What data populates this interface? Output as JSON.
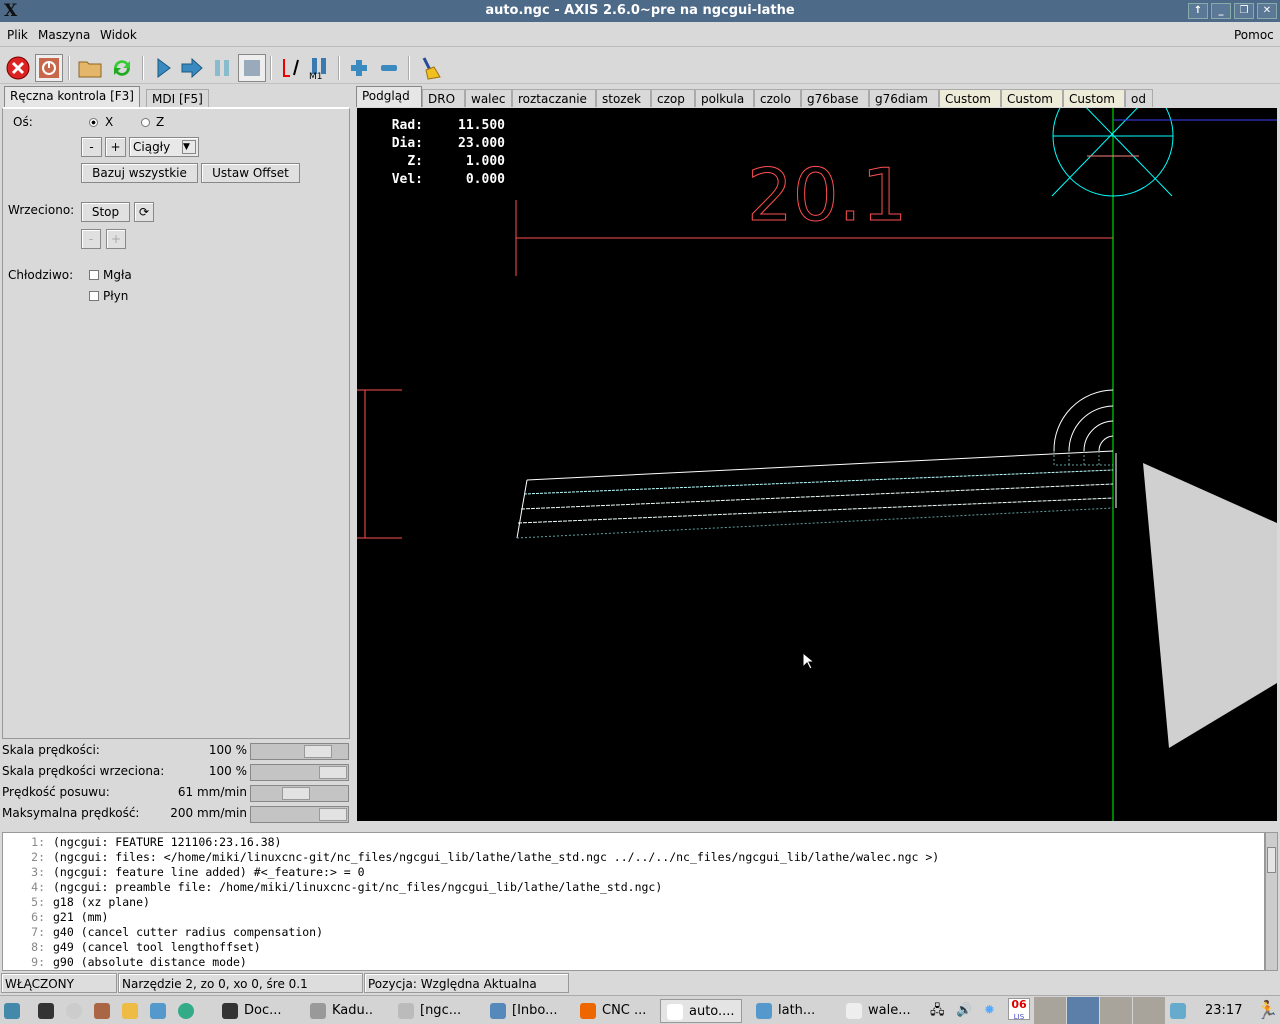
{
  "window": {
    "title": "auto.ngc - AXIS 2.6.0~pre na ngcgui-lathe",
    "logo": "X"
  },
  "menu": {
    "items": [
      "Plik",
      "Maszyna",
      "Widok"
    ],
    "help": "Pomoc"
  },
  "toolbar": {
    "icons": [
      "estop-icon",
      "power-icon",
      "open-file-icon",
      "reload-icon",
      "run-icon",
      "step-icon",
      "pause-icon",
      "stop-icon",
      "run-from-line-icon",
      "optional-stop-icon",
      "zoom-in-icon",
      "zoom-out-icon",
      "clear-plot-icon"
    ],
    "m1_label": "M1"
  },
  "left_tabs": [
    "Ręczna kontrola [F3]",
    "MDI [F5]"
  ],
  "manual": {
    "axis_label": "Oś:",
    "axis_x": "X",
    "axis_z": "Z",
    "axis_selected": "X",
    "minus": "-",
    "plus": "+",
    "jog_mode": "Ciągły",
    "home_all": "Bazuj wszystkie",
    "touch_off": "Ustaw Offset",
    "spindle_label": "Wrzeciono:",
    "spindle_stop": "Stop",
    "coolant_label": "Chłodziwo:",
    "mist": "Mgła",
    "flood": "Płyn"
  },
  "sliders": [
    {
      "label": "Skala prędkości:",
      "value": "100 %",
      "fraction": 0.78
    },
    {
      "label": "Skala prędkości wrzeciona:",
      "value": "100 %",
      "fraction": 1.0
    },
    {
      "label": "Prędkość posuwu:",
      "value": "61 mm/min",
      "fraction": 0.45
    },
    {
      "label": "Maksymalna prędkość:",
      "value": "200 mm/min",
      "fraction": 1.0
    }
  ],
  "right_tabs": [
    "Podgląd",
    "DRO",
    "walec",
    "roztaczanie",
    "stozek",
    "czop",
    "polkula",
    "czolo",
    "g76base",
    "g76diam",
    "Custom",
    "Custom",
    "Custom",
    "od"
  ],
  "dro": [
    {
      "label": "Rad:",
      "value": "11.500"
    },
    {
      "label": "Dia:",
      "value": "23.000"
    },
    {
      "label": "Z:",
      "value": "1.000"
    },
    {
      "label": "Vel:",
      "value": "0.000"
    }
  ],
  "preview": {
    "dimension": "20.1",
    "colors": {
      "dimension": "#ff5050",
      "spindle_axis": "#00ff00",
      "tool": "#00ffff",
      "path": "#ffffff",
      "rapid": "#5fa0a0"
    }
  },
  "console": [
    "(ngcgui: FEATURE 121106:23.16.38)",
    "(ngcgui: files: </home/miki/linuxcnc-git/nc_files/ngcgui_lib/lathe/lathe_std.ngc ../../../nc_files/ngcgui_lib/lathe/walec.ngc >)",
    "(ngcgui: feature line added) #<_feature:> = 0",
    "(ngcgui: preamble file: /home/miki/linuxcnc-git/nc_files/ngcgui_lib/lathe/lathe_std.ngc)",
    "g18 (xz plane)",
    "g21 (mm)",
    "g40 (cancel cutter radius compensation)",
    "g49 (cancel tool lengthoffset)",
    "g90 (absolute distance mode)"
  ],
  "status": {
    "state": "WŁĄCZONY",
    "tool": "Narzędzie 2, zo 0, xo 0, śre 0.1",
    "position": "Pozycja: Względna Aktualna"
  },
  "taskbar": {
    "tasks": [
      "Doc...",
      "Kadu..",
      "[ngc...",
      "[Inbo...",
      "CNC ...",
      "auto....",
      "lath...",
      "wale..."
    ],
    "calendar_day": "06",
    "calendar_month": "LIS",
    "clock": "23:17"
  }
}
